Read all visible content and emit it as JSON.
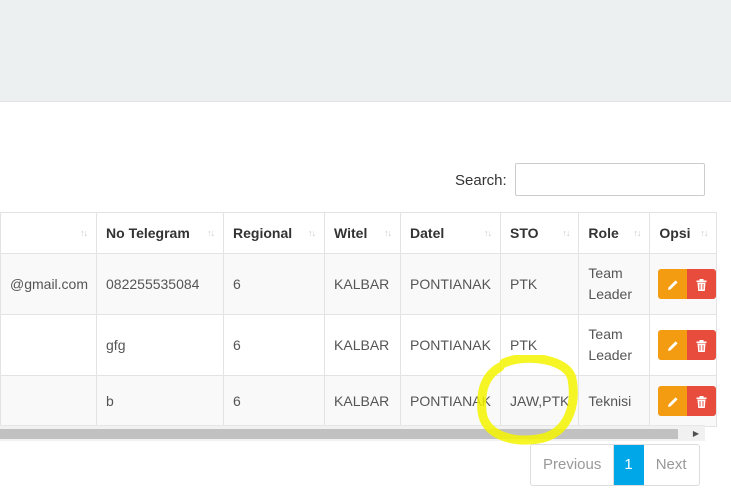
{
  "search": {
    "label": "Search:",
    "value": ""
  },
  "table": {
    "headers": [
      "No Telegram",
      "Regional",
      "Witel",
      "Datel",
      "STO",
      "Role",
      "Opsi"
    ],
    "rows": [
      {
        "email": "@gmail.com",
        "telegram": "082255535084",
        "regional": "6",
        "witel": "KALBAR",
        "datel": "PONTIANAK",
        "sto": "PTK",
        "role": "Team Leader"
      },
      {
        "email": "",
        "telegram": "gfg",
        "regional": "6",
        "witel": "KALBAR",
        "datel": "PONTIANAK",
        "sto": "PTK",
        "role": "Team Leader"
      },
      {
        "email": "",
        "telegram": "b",
        "regional": "6",
        "witel": "KALBAR",
        "datel": "PONTIANAK",
        "sto": "JAW,PTK",
        "role": "Teknisi"
      }
    ]
  },
  "pagination": {
    "previous": "Previous",
    "current": "1",
    "next": "Next"
  },
  "colors": {
    "edit": "#f39c12",
    "delete": "#e74c3c",
    "active_page": "#00a7e8",
    "highlight": "#f5f500"
  },
  "icons": {
    "edit": "pencil-icon",
    "delete": "trash-icon",
    "sort": "sort-both-icon",
    "scroll_right": "triangle-right-icon"
  }
}
